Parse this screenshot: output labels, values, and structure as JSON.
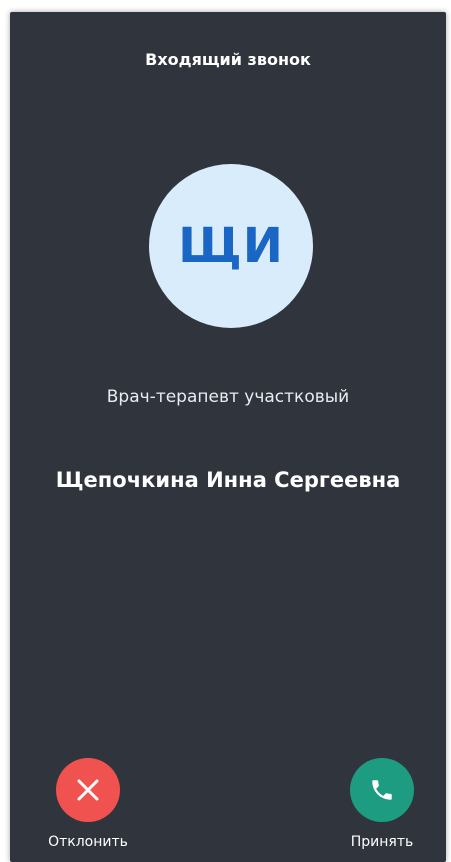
{
  "header": {
    "title": "Входящий звонок"
  },
  "caller": {
    "initials": "ЩИ",
    "role": "Врач-терапевт участковый",
    "name": "Щепочкина Инна Сергеевна"
  },
  "actions": {
    "decline": {
      "label": "Отклонить",
      "icon": "close-icon",
      "color": "#f0524f"
    },
    "accept": {
      "label": "Принять",
      "icon": "phone-icon",
      "color": "#1d9c82"
    }
  },
  "colors": {
    "background": "#30353d",
    "avatar_bg": "#d9ecfb",
    "avatar_text": "#1a66c4"
  }
}
